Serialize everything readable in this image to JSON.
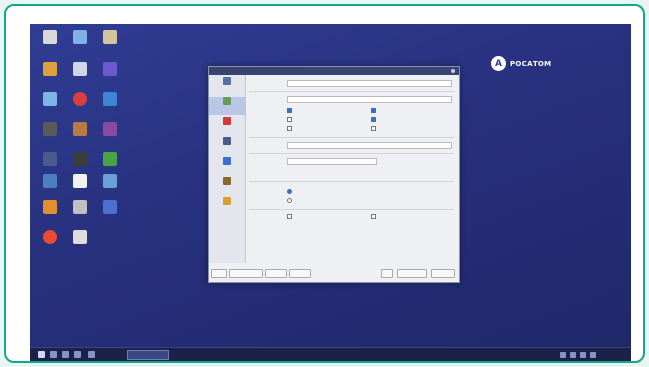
{
  "brand": {
    "logo_text": "РОСАТОМ",
    "frame_color": "#17a58b",
    "desktop_color": "#2f3d93"
  },
  "desktop_icons": [
    {
      "icon": "file-icon",
      "color": "#d9d9d9"
    },
    {
      "icon": "monitor-icon",
      "color": "#7fb0e6"
    },
    {
      "icon": "notebook-icon",
      "color": "#d2c79a"
    },
    {
      "icon": "app-icon",
      "color": "#e0a040"
    },
    {
      "icon": "document-icon",
      "color": "#cfd6e8"
    },
    {
      "icon": "music-icon",
      "color": "#6a5acd"
    },
    {
      "icon": "image-icon",
      "color": "#7fb4e6"
    },
    {
      "icon": "target-icon",
      "color": "#d84040"
    },
    {
      "icon": "folder-icon",
      "color": "#3d86d6"
    },
    {
      "icon": "printer-icon",
      "color": "#5a5a5a"
    },
    {
      "icon": "user-icon",
      "color": "#b97b45"
    },
    {
      "icon": "archive-icon",
      "color": "#8b4a9f"
    },
    {
      "icon": "monitor-icon",
      "color": "#4a5c8c"
    },
    {
      "icon": "terminal-icon",
      "color": "#3c3c3c"
    },
    {
      "icon": "app-icon",
      "color": "#47a447"
    },
    {
      "icon": "screen-icon",
      "color": "#4a80c0"
    },
    {
      "icon": "document-icon",
      "color": "#f2f2f2"
    },
    {
      "icon": "calendar-icon",
      "color": "#6aa0d8"
    },
    {
      "icon": "people-icon",
      "color": "#e09030"
    },
    {
      "icon": "people-icon",
      "color": "#c0c0c0"
    },
    {
      "icon": "cube-icon",
      "color": "#4a70d0"
    },
    {
      "icon": "browser-icon",
      "color": "#e94b35"
    },
    {
      "icon": "document-icon",
      "color": "#dddddd"
    }
  ],
  "settings_window": {
    "title": "",
    "categories": [
      {
        "icon": "window-icon",
        "color": "#5a6fa0",
        "selected": false
      },
      {
        "icon": "panel-icon",
        "color": "#6a9a5a",
        "selected": true
      },
      {
        "icon": "font-icon",
        "color": "#d23b3b",
        "selected": false
      },
      {
        "icon": "desktop-icon",
        "color": "#4a5a88",
        "selected": false
      },
      {
        "icon": "brush-icon",
        "color": "#3a6fd1",
        "selected": false
      },
      {
        "icon": "clock-icon",
        "color": "#8a6a2a",
        "selected": false
      },
      {
        "icon": "gear-icon",
        "color": "#d8a030",
        "selected": false
      }
    ],
    "options_left": [
      {
        "checked": true
      },
      {
        "checked": false
      },
      {
        "checked": false
      }
    ],
    "options_right": [
      {
        "checked": true
      },
      {
        "checked": true
      },
      {
        "checked": false
      }
    ],
    "radio_options": [
      {
        "checked": true
      },
      {
        "checked": false
      }
    ],
    "combo_options": [
      {
        "checked": false
      },
      {
        "checked": false
      }
    ],
    "buttons": [
      {
        "label": ""
      },
      {
        "label": ""
      },
      {
        "label": ""
      },
      {
        "label": ""
      },
      {
        "label": ""
      },
      {
        "label": ""
      },
      {
        "label": ""
      }
    ]
  },
  "taskbar": {
    "task_label": "",
    "clock": ""
  }
}
